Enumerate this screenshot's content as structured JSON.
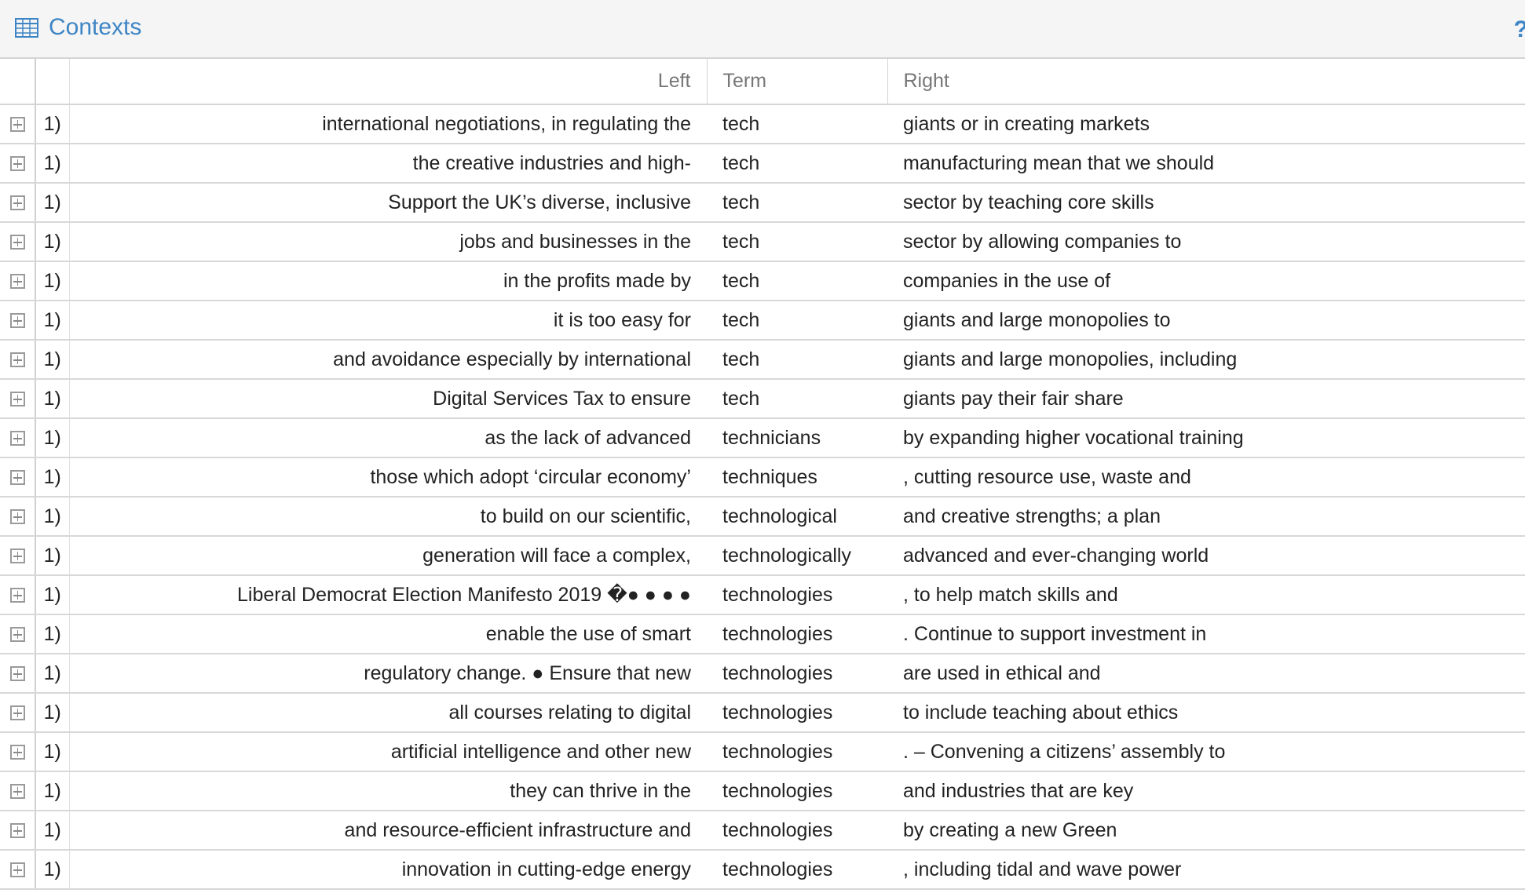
{
  "header": {
    "title": "Contexts",
    "help_label": "?",
    "icon": "table-grid-icon",
    "accent_color": "#3e85c5"
  },
  "table": {
    "columns": {
      "left": "Left",
      "term": "Term",
      "right": "Right"
    },
    "rows": [
      {
        "num": "1)",
        "left": "international negotiations, in regulating the",
        "term": "tech",
        "right": "giants or in creating markets"
      },
      {
        "num": "1)",
        "left": "the creative industries and high-",
        "term": "tech",
        "right": "manufacturing mean that we should"
      },
      {
        "num": "1)",
        "left": "Support the UK’s diverse, inclusive",
        "term": "tech",
        "right": "sector by teaching core skills"
      },
      {
        "num": "1)",
        "left": "jobs and businesses in the",
        "term": "tech",
        "right": "sector by allowing companies to"
      },
      {
        "num": "1)",
        "left": "in the profits made by",
        "term": "tech",
        "right": "companies in the use of"
      },
      {
        "num": "1)",
        "left": "it is too easy for",
        "term": "tech",
        "right": "giants and large monopolies to"
      },
      {
        "num": "1)",
        "left": "and avoidance especially by international",
        "term": "tech",
        "right": "giants and large monopolies, including"
      },
      {
        "num": "1)",
        "left": "Digital Services Tax to ensure",
        "term": "tech",
        "right": "giants pay their fair share"
      },
      {
        "num": "1)",
        "left": "as the lack of advanced",
        "term": "technicians",
        "right": "by expanding higher vocational training"
      },
      {
        "num": "1)",
        "left": "those which adopt ‘circular economy’",
        "term": "techniques",
        "right": ", cutting resource use, waste and"
      },
      {
        "num": "1)",
        "left": "to build on our scientific,",
        "term": "technological",
        "right": "and creative strengths; a plan"
      },
      {
        "num": "1)",
        "left": "generation will face a complex,",
        "term": "technologically",
        "right": "advanced and ever-changing world"
      },
      {
        "num": "1)",
        "left": "Liberal Democrat Election Manifesto 2019 �● ● ● ●",
        "term": "technologies",
        "right": ", to help match skills and"
      },
      {
        "num": "1)",
        "left": "enable the use of smart",
        "term": "technologies",
        "right": ". Continue to support investment in"
      },
      {
        "num": "1)",
        "left": "regulatory change. ● Ensure that new",
        "term": "technologies",
        "right": "are used in ethical and"
      },
      {
        "num": "1)",
        "left": "all courses relating to digital",
        "term": "technologies",
        "right": "to include teaching about ethics"
      },
      {
        "num": "1)",
        "left": "artificial intelligence and other new",
        "term": "technologies",
        "right": ". – Convening a citizens’ assembly to"
      },
      {
        "num": "1)",
        "left": "they can thrive in the",
        "term": "technologies",
        "right": "and industries that are key"
      },
      {
        "num": "1)",
        "left": "and resource-efficient infrastructure and",
        "term": "technologies",
        "right": "by creating a new Green"
      },
      {
        "num": "1)",
        "left": "innovation in cutting-edge energy",
        "term": "technologies",
        "right": ", including tidal and wave power"
      }
    ]
  }
}
